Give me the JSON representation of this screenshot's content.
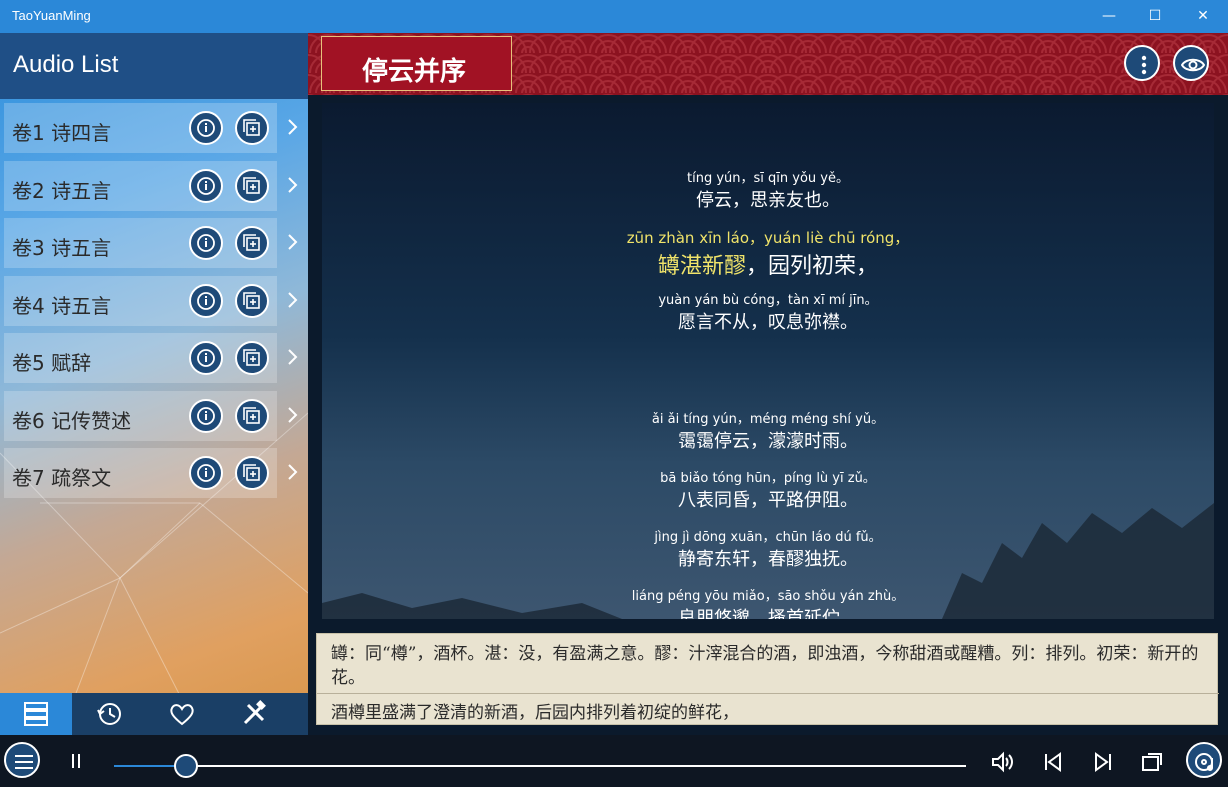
{
  "window": {
    "title": "TaoYuanMing",
    "minimize": "—",
    "maximize": "☐",
    "close": "✕"
  },
  "sidebar": {
    "title": "Audio List",
    "items": [
      {
        "label": "卷1 诗四言"
      },
      {
        "label": "卷2 诗五言"
      },
      {
        "label": "卷3 诗五言"
      },
      {
        "label": "卷4 诗五言"
      },
      {
        "label": "卷5 赋辞"
      },
      {
        "label": "卷6 记传赞述"
      },
      {
        "label": "卷7 疏祭文"
      }
    ],
    "tabs": [
      "list-icon",
      "history-icon",
      "heart-icon",
      "tools-icon"
    ]
  },
  "poem": {
    "title": "停云并序",
    "lines": [
      {
        "pinyin": "tíng yún，sī qīn yǒu yě。",
        "hanzi": "停云，思亲友也。"
      },
      {
        "pinyin": "zūn zhàn xīn láo，yuán liè chū róng，",
        "hanzi_hl": "罇湛新醪",
        "hanzi_rest": "，园列初荣，",
        "highlight": true
      },
      {
        "pinyin": "yuàn yán bù cóng，tàn xī mí jīn。",
        "hanzi": "愿言不从，叹息弥襟。"
      },
      {
        "pinyin": "ǎi ǎi tíng yún，méng méng shí yǔ。",
        "hanzi": "霭霭停云，濛濛时雨。"
      },
      {
        "pinyin": "bā biǎo tóng hūn，píng lù yī zǔ。",
        "hanzi": "八表同昏，平路伊阻。"
      },
      {
        "pinyin": "jìng jì dōng xuān，chūn láo dú fǔ。",
        "hanzi": "静寄东轩，春醪独抚。"
      },
      {
        "pinyin": "liáng péng yōu miǎo，sāo shǒu yán zhù。",
        "hanzi": "良朋悠邈，搔首延伫。"
      }
    ]
  },
  "notes": {
    "annotation": "罇：同“樽”，酒杯。湛：没，有盈满之意。醪：汁滓混合的酒，即浊酒，今称甜酒或醒糟。列：排列。初荣：新开的花。",
    "translation": "酒樽里盛满了澄清的新酒，后园内排列着初绽的鲜花，"
  },
  "player": {
    "progress": 0.085,
    "state": "playing"
  },
  "colors": {
    "accent": "#2b88d8",
    "banner": "#8c1220",
    "highlight": "#f1e46a"
  }
}
